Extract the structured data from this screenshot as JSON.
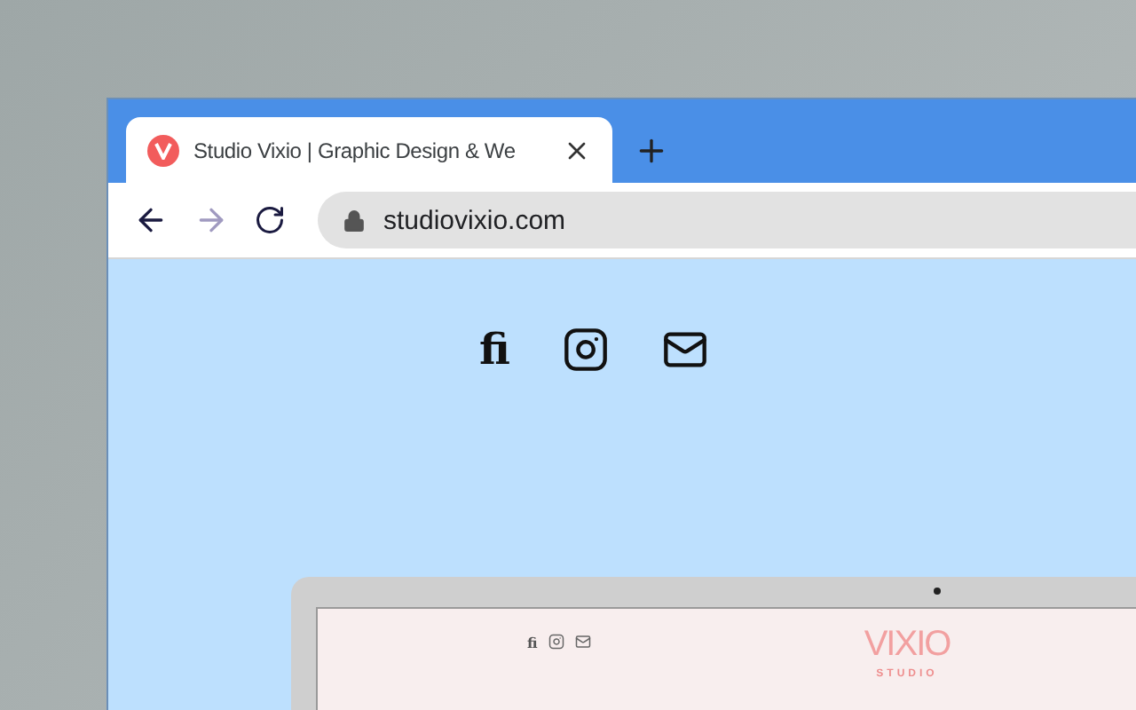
{
  "tab": {
    "title": "Studio Vixio | Graphic Design & We",
    "selected": true
  },
  "address_bar": {
    "url": "studiovixio.com"
  },
  "page": {
    "social_links": [
      {
        "kind": "fi",
        "text": "fi"
      },
      {
        "kind": "instagram"
      },
      {
        "kind": "mail"
      }
    ],
    "laptop_screen": {
      "logo": "VIXIO",
      "tagline": "STUDIO"
    }
  }
}
